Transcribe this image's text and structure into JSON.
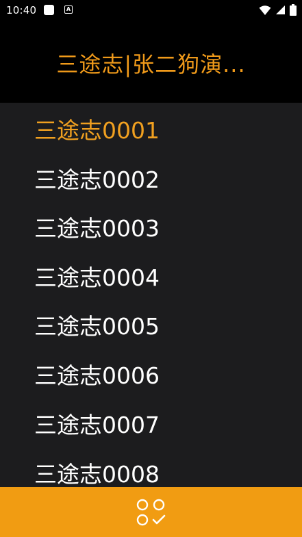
{
  "status_bar": {
    "time": "10:40",
    "notification_icon": "square-app-icon",
    "a_icon_label": "A",
    "wifi_icon": "wifi-icon",
    "signal_icon": "signal-icon",
    "battery_icon": "battery-icon"
  },
  "header": {
    "title": "三途志|张二狗演..."
  },
  "episodes": [
    {
      "label": "三途志0001",
      "active": true
    },
    {
      "label": "三途志0002",
      "active": false
    },
    {
      "label": "三途志0003",
      "active": false
    },
    {
      "label": "三途志0004",
      "active": false
    },
    {
      "label": "三途志0005",
      "active": false
    },
    {
      "label": "三途志0006",
      "active": false
    },
    {
      "label": "三途志0007",
      "active": false
    },
    {
      "label": "三途志0008",
      "active": false
    }
  ],
  "bottom_bar": {
    "icon": "select-all-icon"
  },
  "colors": {
    "accent": "#f09a1a",
    "bottom_bar": "#f19c12",
    "list_bg": "#1c1c1e",
    "header_bg": "#000000"
  }
}
